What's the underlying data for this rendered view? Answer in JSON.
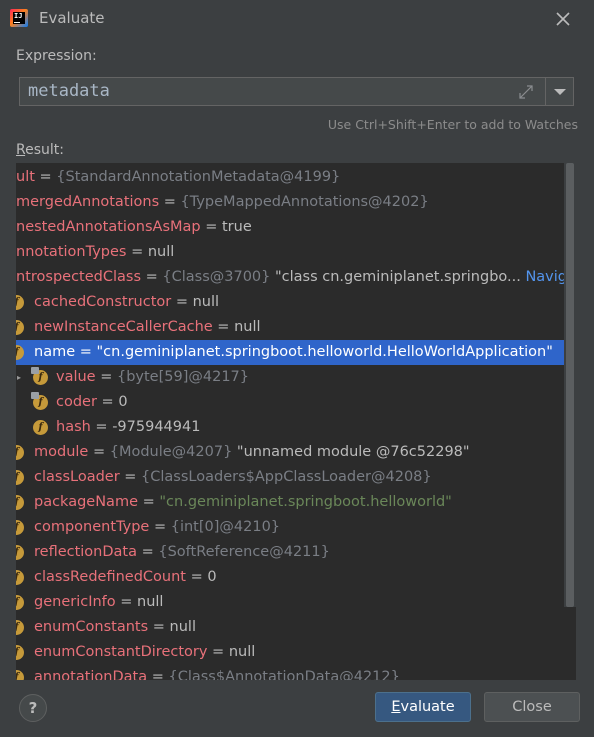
{
  "window": {
    "title": "Evaluate"
  },
  "expression": {
    "label": "Expression:",
    "value": "metadata",
    "hint": "Use Ctrl+Shift+Enter to add to Watches"
  },
  "result": {
    "label_first": "R",
    "label_rest": "esult:",
    "rows": [
      {
        "name": "ult",
        "eq": " = ",
        "ref": "{StandardAnnotationMetadata@4199}",
        "val": "",
        "nav": "",
        "icon": false
      },
      {
        "name": "mergedAnnotations",
        "eq": " = ",
        "ref": "{TypeMappedAnnotations@4202}",
        "val": "",
        "nav": "",
        "icon": false
      },
      {
        "name": "nestedAnnotationsAsMap",
        "eq": " = ",
        "ref": "",
        "val": "true",
        "nav": "",
        "icon": false
      },
      {
        "name": "nnotationTypes",
        "eq": " = ",
        "ref": "",
        "val": "null",
        "nav": "",
        "icon": false
      },
      {
        "name": "ntrospectedClass",
        "eq": " = ",
        "ref": "{Class@3700} ",
        "val": "\"class cn.geminiplanet.springbo...",
        "nav": " Navigate",
        "icon": false
      },
      {
        "name": "cachedConstructor",
        "eq": " = ",
        "ref": "",
        "val": "null",
        "nav": "",
        "icon": true
      },
      {
        "name": "newInstanceCallerCache",
        "eq": " = ",
        "ref": "",
        "val": "null",
        "nav": "",
        "icon": true
      },
      {
        "name": "name",
        "eq": " = ",
        "ref": "",
        "val": "\"cn.geminiplanet.springboot.helloworld.HelloWorldApplication\"",
        "nav": "",
        "icon": true,
        "selected": true
      },
      {
        "name": "value",
        "eq": " = ",
        "ref": "{byte[59]@4217}",
        "val": "",
        "nav": "",
        "icon": true,
        "child": true,
        "expander": true
      },
      {
        "name": "coder",
        "eq": " = ",
        "ref": "",
        "val": "0",
        "nav": "",
        "icon": true,
        "child": true
      },
      {
        "name": "hash",
        "eq": " = ",
        "ref": "",
        "val": "-975944941",
        "nav": "",
        "icon": true,
        "child": true
      },
      {
        "name": "module",
        "eq": " = ",
        "ref": "{Module@4207} ",
        "val": "\"unnamed module @76c52298\"",
        "nav": "",
        "icon": true
      },
      {
        "name": "classLoader",
        "eq": " = ",
        "ref": "{ClassLoaders$AppClassLoader@4208}",
        "val": "",
        "nav": "",
        "icon": true
      },
      {
        "name": "packageName",
        "eq": " = ",
        "ref": "",
        "val": "\"cn.geminiplanet.springboot.helloworld\"",
        "nav": "",
        "icon": true,
        "green": true
      },
      {
        "name": "componentType",
        "eq": " = ",
        "ref": "{int[0]@4210}",
        "val": "",
        "nav": "",
        "icon": true
      },
      {
        "name": "reflectionData",
        "eq": " = ",
        "ref": "{SoftReference@4211}",
        "val": "",
        "nav": "",
        "icon": true
      },
      {
        "name": "classRedefinedCount",
        "eq": " = ",
        "ref": "",
        "val": "0",
        "nav": "",
        "icon": true
      },
      {
        "name": "genericInfo",
        "eq": " = ",
        "ref": "",
        "val": "null",
        "nav": "",
        "icon": true
      },
      {
        "name": "enumConstants",
        "eq": " = ",
        "ref": "",
        "val": "null",
        "nav": "",
        "icon": true
      },
      {
        "name": "enumConstantDirectory",
        "eq": " = ",
        "ref": "",
        "val": "null",
        "nav": "",
        "icon": true
      },
      {
        "name": "annotationData",
        "eq": " = ",
        "ref": "{Class$AnnotationData@4212}",
        "val": "",
        "nav": "",
        "icon": true
      }
    ]
  },
  "buttons": {
    "help": "?",
    "evaluate_first": "",
    "evaluate_mnemonic": "E",
    "evaluate_rest": "valuate",
    "close": "Close"
  },
  "icons": {
    "field": "field-icon",
    "window_close": "close-icon",
    "expand": "expand-icon",
    "dropdown": "chevron-down-icon"
  },
  "colors": {
    "background": "#3c3f41",
    "tree_background": "#2b2b2b",
    "selection": "#2f65ca",
    "field_name": "#e8717a",
    "reference": "#7a7e85",
    "string": "#6a8759",
    "link": "#5394ec",
    "primary_button": "#365880"
  }
}
